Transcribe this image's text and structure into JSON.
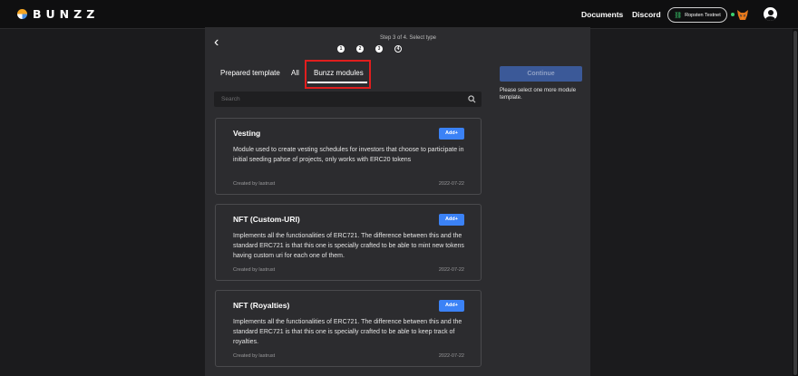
{
  "header": {
    "brand": "BUNZZ",
    "nav": [
      "Documents",
      "Discord"
    ],
    "network": "Ropsten Testnet",
    "icons": [
      "bunzz-logo-icon",
      "network-icon",
      "metamask-fox-icon",
      "account-icon"
    ],
    "colors": {
      "accent": "#3b82f6",
      "status": "#3bd16f"
    }
  },
  "wizard": {
    "step_title": "Step 3 of 4. Select type",
    "steps": [
      "1",
      "2",
      "3",
      "4"
    ],
    "current_step": 3
  },
  "tabs": [
    "Prepared template",
    "All",
    "Bunzz modules"
  ],
  "active_tab": "Bunzz modules",
  "search": {
    "placeholder": "Search",
    "value": ""
  },
  "modules": [
    {
      "title": "Vesting",
      "add_label": "Add+",
      "description": "Module used to create vesting schedules for investors that choose to participate in initial seeding pahse of projects, only works with ERC20 tokens",
      "author": "Created by lastrust",
      "date": "2022-07-22"
    },
    {
      "title": "NFT (Custom-URI)",
      "add_label": "Add+",
      "description": "Implements all the functionalities of ERC721. The difference between this and the standard ERC721 is that this one is specially crafted to be able to mint new tokens having custom uri for each one of them.",
      "author": "Created by lastrust",
      "date": "2022-07-22"
    },
    {
      "title": "NFT (Royalties)",
      "add_label": "Add+",
      "description": "Implements all the functionalities of ERC721. The difference between this and the standard ERC721 is that this one is specially crafted to be able to keep track of royalties.",
      "author": "Created by lastrust",
      "date": "2022-07-22"
    }
  ],
  "sidebar": {
    "continue_label": "Continue",
    "hint": "Please select one more module template."
  }
}
